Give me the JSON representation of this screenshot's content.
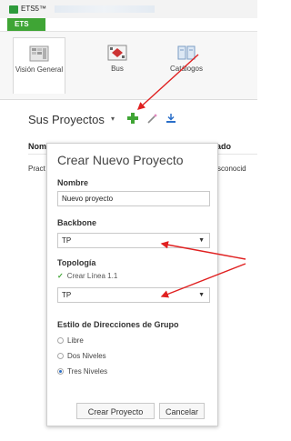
{
  "window": {
    "title": "ETS5™"
  },
  "ribbon": {
    "tab": "ETS",
    "buttons": [
      {
        "label": "Visión General",
        "icon": "overview-icon"
      },
      {
        "label": "Bus",
        "icon": "bus-icon"
      },
      {
        "label": "Catálogos",
        "icon": "catalog-icon"
      }
    ]
  },
  "projects": {
    "header": "Sus Proyectos",
    "columns": {
      "name": "Nom",
      "state": "ado"
    },
    "row": {
      "name": "Pract",
      "state": "sconocid"
    }
  },
  "dialog": {
    "title": "Crear Nuevo Proyecto",
    "name_label": "Nombre",
    "name_value": "Nuevo proyecto",
    "backbone_label": "Backbone",
    "backbone_value": "TP",
    "topology_label": "Topología",
    "create_line_label": "Crear Línea 1.1",
    "create_line_checked": true,
    "topology_value": "TP",
    "group_style_label": "Estilo de Direcciones de Grupo",
    "group_style_options": [
      "Libre",
      "Dos Niveles",
      "Tres Niveles"
    ],
    "group_style_selected": "Tres Niveles",
    "create_button": "Crear Proyecto",
    "cancel_button": "Cancelar"
  },
  "colors": {
    "accent_green": "#3fa535",
    "arrow_red": "#e02020",
    "radio_blue": "#2a6fc9"
  }
}
